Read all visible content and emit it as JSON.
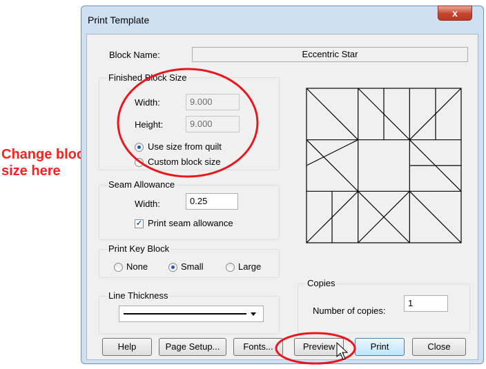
{
  "window": {
    "title": "Print Template",
    "close_glyph": "x"
  },
  "block_name": {
    "label": "Block Name:",
    "value": "Eccentric Star"
  },
  "finished_block_size": {
    "group_label": "Finished Block Size",
    "width_label": "Width:",
    "width_value": "9.000",
    "height_label": "Height:",
    "height_value": "9.000",
    "use_size_label": "Use size from quilt",
    "custom_size_label": "Custom block size",
    "selected": "Use size from quilt"
  },
  "seam_allowance": {
    "group_label": "Seam Allowance",
    "width_label": "Width:",
    "width_value": "0.25",
    "print_label": "Print seam allowance",
    "print_checked": true
  },
  "print_key_block": {
    "group_label": "Print Key Block",
    "options": [
      "None",
      "Small",
      "Large"
    ],
    "selected": "Small"
  },
  "line_thickness": {
    "group_label": "Line Thickness"
  },
  "copies": {
    "group_label": "Copies",
    "label": "Number of copies:",
    "value": "1"
  },
  "buttons": {
    "help": "Help",
    "page_setup": "Page Setup...",
    "fonts": "Fonts...",
    "preview": "Preview",
    "print": "Print",
    "close": "Close"
  },
  "annotation": {
    "line1": "Change block",
    "line2": "size here",
    "color": "#ff1e1e"
  }
}
